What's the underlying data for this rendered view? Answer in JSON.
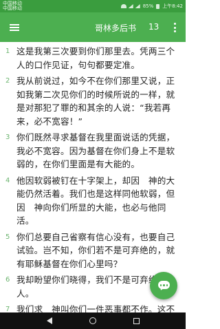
{
  "status_bar": {
    "carrier_line1": "中国移动",
    "carrier_line2": "中国移动",
    "battery": "85%",
    "time": "上午8:42"
  },
  "app_bar": {
    "menu_icon": "hamburger-menu-icon",
    "book_title": "哥林多后书",
    "chapter": "13",
    "overflow_icon": "more-vert-icon"
  },
  "verses": [
    {
      "num": "1",
      "text": "这是我第三次要到你们那里去。凭两三个人的口作见证，句句都要定准。"
    },
    {
      "num": "2",
      "text": "我从前说过，如今不在你们那里又说，正如我第二次见你们的时候所说的一样，就是对那犯了罪的和其余的人说：“我若再来，必不宽容！”"
    },
    {
      "num": "3",
      "text": "你们既然寻求基督在我里面说话的凭据，我必不宽容。因为基督在你们身上不是软弱的，在你们里面是有大能的。"
    },
    {
      "num": "4",
      "text": "他因软弱被钉在十字架上，却因　神的大能仍然活着。我们也是这样同他软弱，但因　神向你们所显的大能，也必与他同活。"
    },
    {
      "num": "5",
      "text": "你们总要自己省察有信心没有，也要自己试验。岂不知，你们若不是可弃绝的，就有耶稣基督在你们心里吗？"
    },
    {
      "num": "6",
      "text": "我却盼望你们晓得，我们不是可弃绝的人。"
    },
    {
      "num": "7",
      "text": "我们求　神叫你们一件恶事都不作。这不是要显明我们是蒙悦纳的，是要你们行事端正，任凭人看我们是可弃绝的吧。"
    }
  ],
  "fab": {
    "icon": "chat-bubble-icon"
  },
  "nav_bar": {
    "back_icon": "back-icon",
    "home_icon": "home-icon",
    "recents_icon": "recents-icon"
  },
  "colors": {
    "status_bar": "#3a9d3e",
    "app_bar": "#4caf50",
    "verse_number": "#6cb46f",
    "text": "#222222",
    "nav_bar": "#111111"
  }
}
